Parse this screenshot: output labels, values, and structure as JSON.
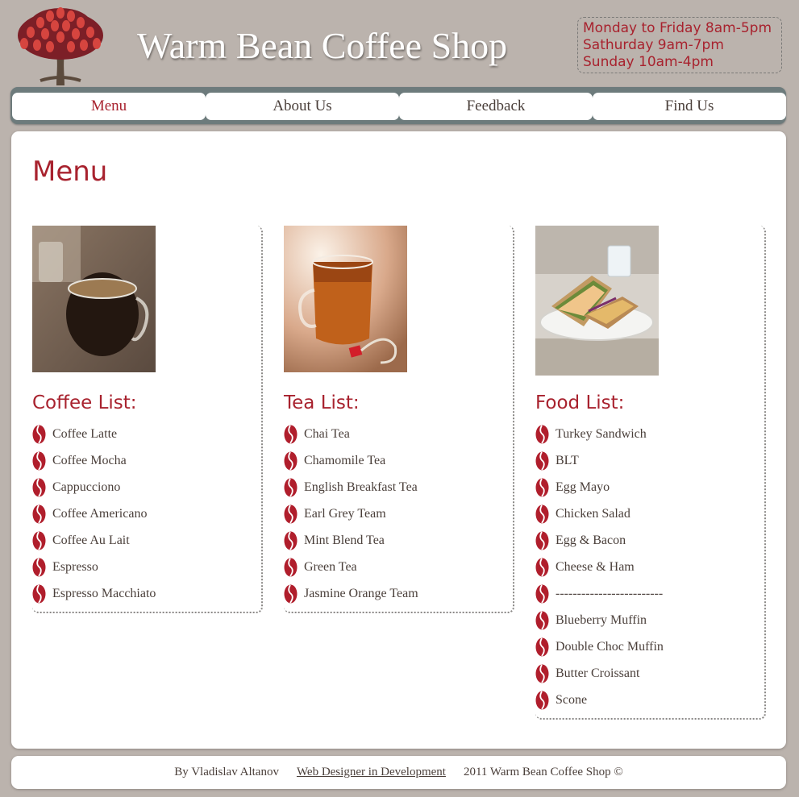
{
  "header": {
    "title": "Warm Bean Coffee Shop",
    "logo_icon": "coffee-tree-logo",
    "hours": [
      "Monday to Friday 8am-5pm",
      "Sathurday 9am-7pm",
      "Sunday 10am-4pm"
    ]
  },
  "nav": {
    "items": [
      {
        "label": "Menu",
        "active": true
      },
      {
        "label": "About Us",
        "active": false
      },
      {
        "label": "Feedback",
        "active": false
      },
      {
        "label": "Find Us",
        "active": false
      }
    ]
  },
  "main": {
    "title": "Menu",
    "columns": [
      {
        "heading": "Coffee List:",
        "image_icon": "coffee-cup-photo",
        "items": [
          "Coffee Latte",
          "Coffee Mocha",
          "Cappucciono",
          "Coffee Americano",
          "Coffee Au Lait",
          "Espresso",
          "Espresso Macchiato"
        ]
      },
      {
        "heading": "Tea List:",
        "image_icon": "tea-glass-photo",
        "items": [
          "Chai Tea",
          "Chamomile Tea",
          "English Breakfast Tea",
          "Earl Grey Team",
          "Mint Blend Tea",
          "Green Tea",
          "Jasmine Orange Team"
        ]
      },
      {
        "heading": "Food List:",
        "image_icon": "sandwich-photo",
        "items": [
          "Turkey Sandwich",
          "BLT",
          "Egg Mayo",
          "Chicken Salad",
          "Egg & Bacon",
          "Cheese & Ham",
          "-------------------------",
          "Blueberry Muffin",
          "Double Choc Muffin",
          "Butter Croissant",
          "Scone"
        ]
      }
    ],
    "bullet_icon": "coffee-bean-icon"
  },
  "footer": {
    "author": "By Vladislav Altanov",
    "link_label": "Web Designer in Development",
    "copyright": "2011 Warm Bean Coffee Shop ©"
  },
  "colors": {
    "background": "#bbb3ad",
    "accent": "#a8222e",
    "nav_bar": "#6d7b7c",
    "text": "#4a3f3a"
  }
}
